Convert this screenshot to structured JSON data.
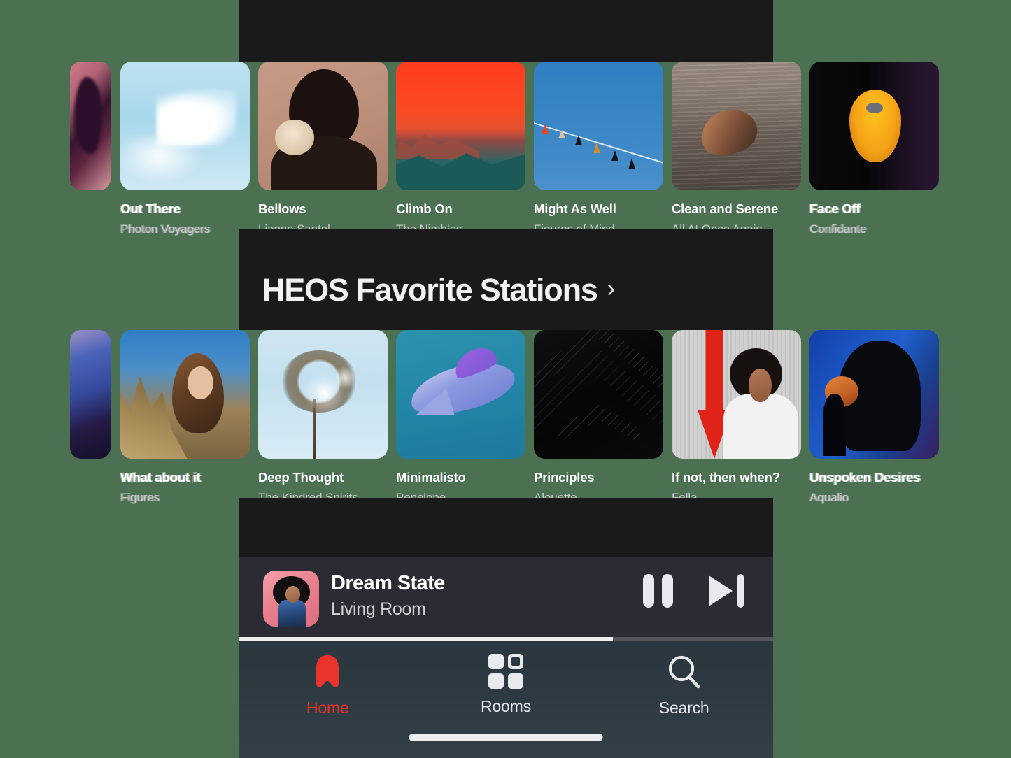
{
  "theme": {
    "page_background": "#4c7052",
    "app_background": "#1a1a1c",
    "now_playing_background": "#2b2c33",
    "tabbar_background": "#2e3a41",
    "accent": "#e8342a",
    "title_color": "#ffffff",
    "subtitle_color": "#c9c9cd"
  },
  "section": {
    "heading": "HEOS Favorite Stations",
    "chevron": "›"
  },
  "rows": [
    {
      "name": "top-row",
      "cards": [
        {
          "title": "",
          "subtitle": "",
          "art": "art-sliver1",
          "sliver": true,
          "outside": true
        },
        {
          "title": "Out There",
          "subtitle": "Photon Voyagers",
          "art": "art-clouds",
          "outside": true
        },
        {
          "title": "Bellows",
          "subtitle": "Lianne Santol",
          "art": "art-bellows",
          "outside": false
        },
        {
          "title": "Climb On",
          "subtitle": "The Nimbles",
          "art": "art-climb",
          "outside": false
        },
        {
          "title": "Might As Well",
          "subtitle": "Figures of Mind",
          "art": "art-birds",
          "outside": false
        },
        {
          "title": "Clean and Serene",
          "subtitle": "All At Once Again",
          "art": "art-water",
          "outside": false
        },
        {
          "title": "Face Off",
          "subtitle": "Confidante",
          "art": "art-faceoff",
          "outside": true
        }
      ]
    },
    {
      "name": "heos-favorite-stations-row",
      "cards": [
        {
          "title": "",
          "subtitle": "",
          "art": "art-sliver2",
          "sliver": true,
          "outside": true
        },
        {
          "title": "What about it",
          "subtitle": "Figures",
          "art": "art-field",
          "outside": true
        },
        {
          "title": "Deep Thought",
          "subtitle": "The Kindred Spirits",
          "art": "art-palm",
          "outside": false
        },
        {
          "title": "Minimalisto",
          "subtitle": "Penelope",
          "art": "art-shark",
          "outside": false
        },
        {
          "title": "Principles",
          "subtitle": "Alouette",
          "art": "art-chevron",
          "outside": false
        },
        {
          "title": "If not, then when?",
          "subtitle": "Fella",
          "art": "art-arrow",
          "outside": false
        },
        {
          "title": "Unspoken Desires",
          "subtitle": "Aqualio",
          "art": "art-blue",
          "outside": true
        }
      ]
    }
  ],
  "now_playing": {
    "track": "Dream State",
    "room": "Living Room",
    "progress_percent": 70,
    "pause_icon": "pause-icon",
    "next_icon": "next-track-icon"
  },
  "tabbar": {
    "items": [
      {
        "label": "Home",
        "icon": "home-icon",
        "active": true
      },
      {
        "label": "Rooms",
        "icon": "rooms-icon",
        "active": false
      },
      {
        "label": "Search",
        "icon": "search-icon",
        "active": false
      }
    ]
  }
}
